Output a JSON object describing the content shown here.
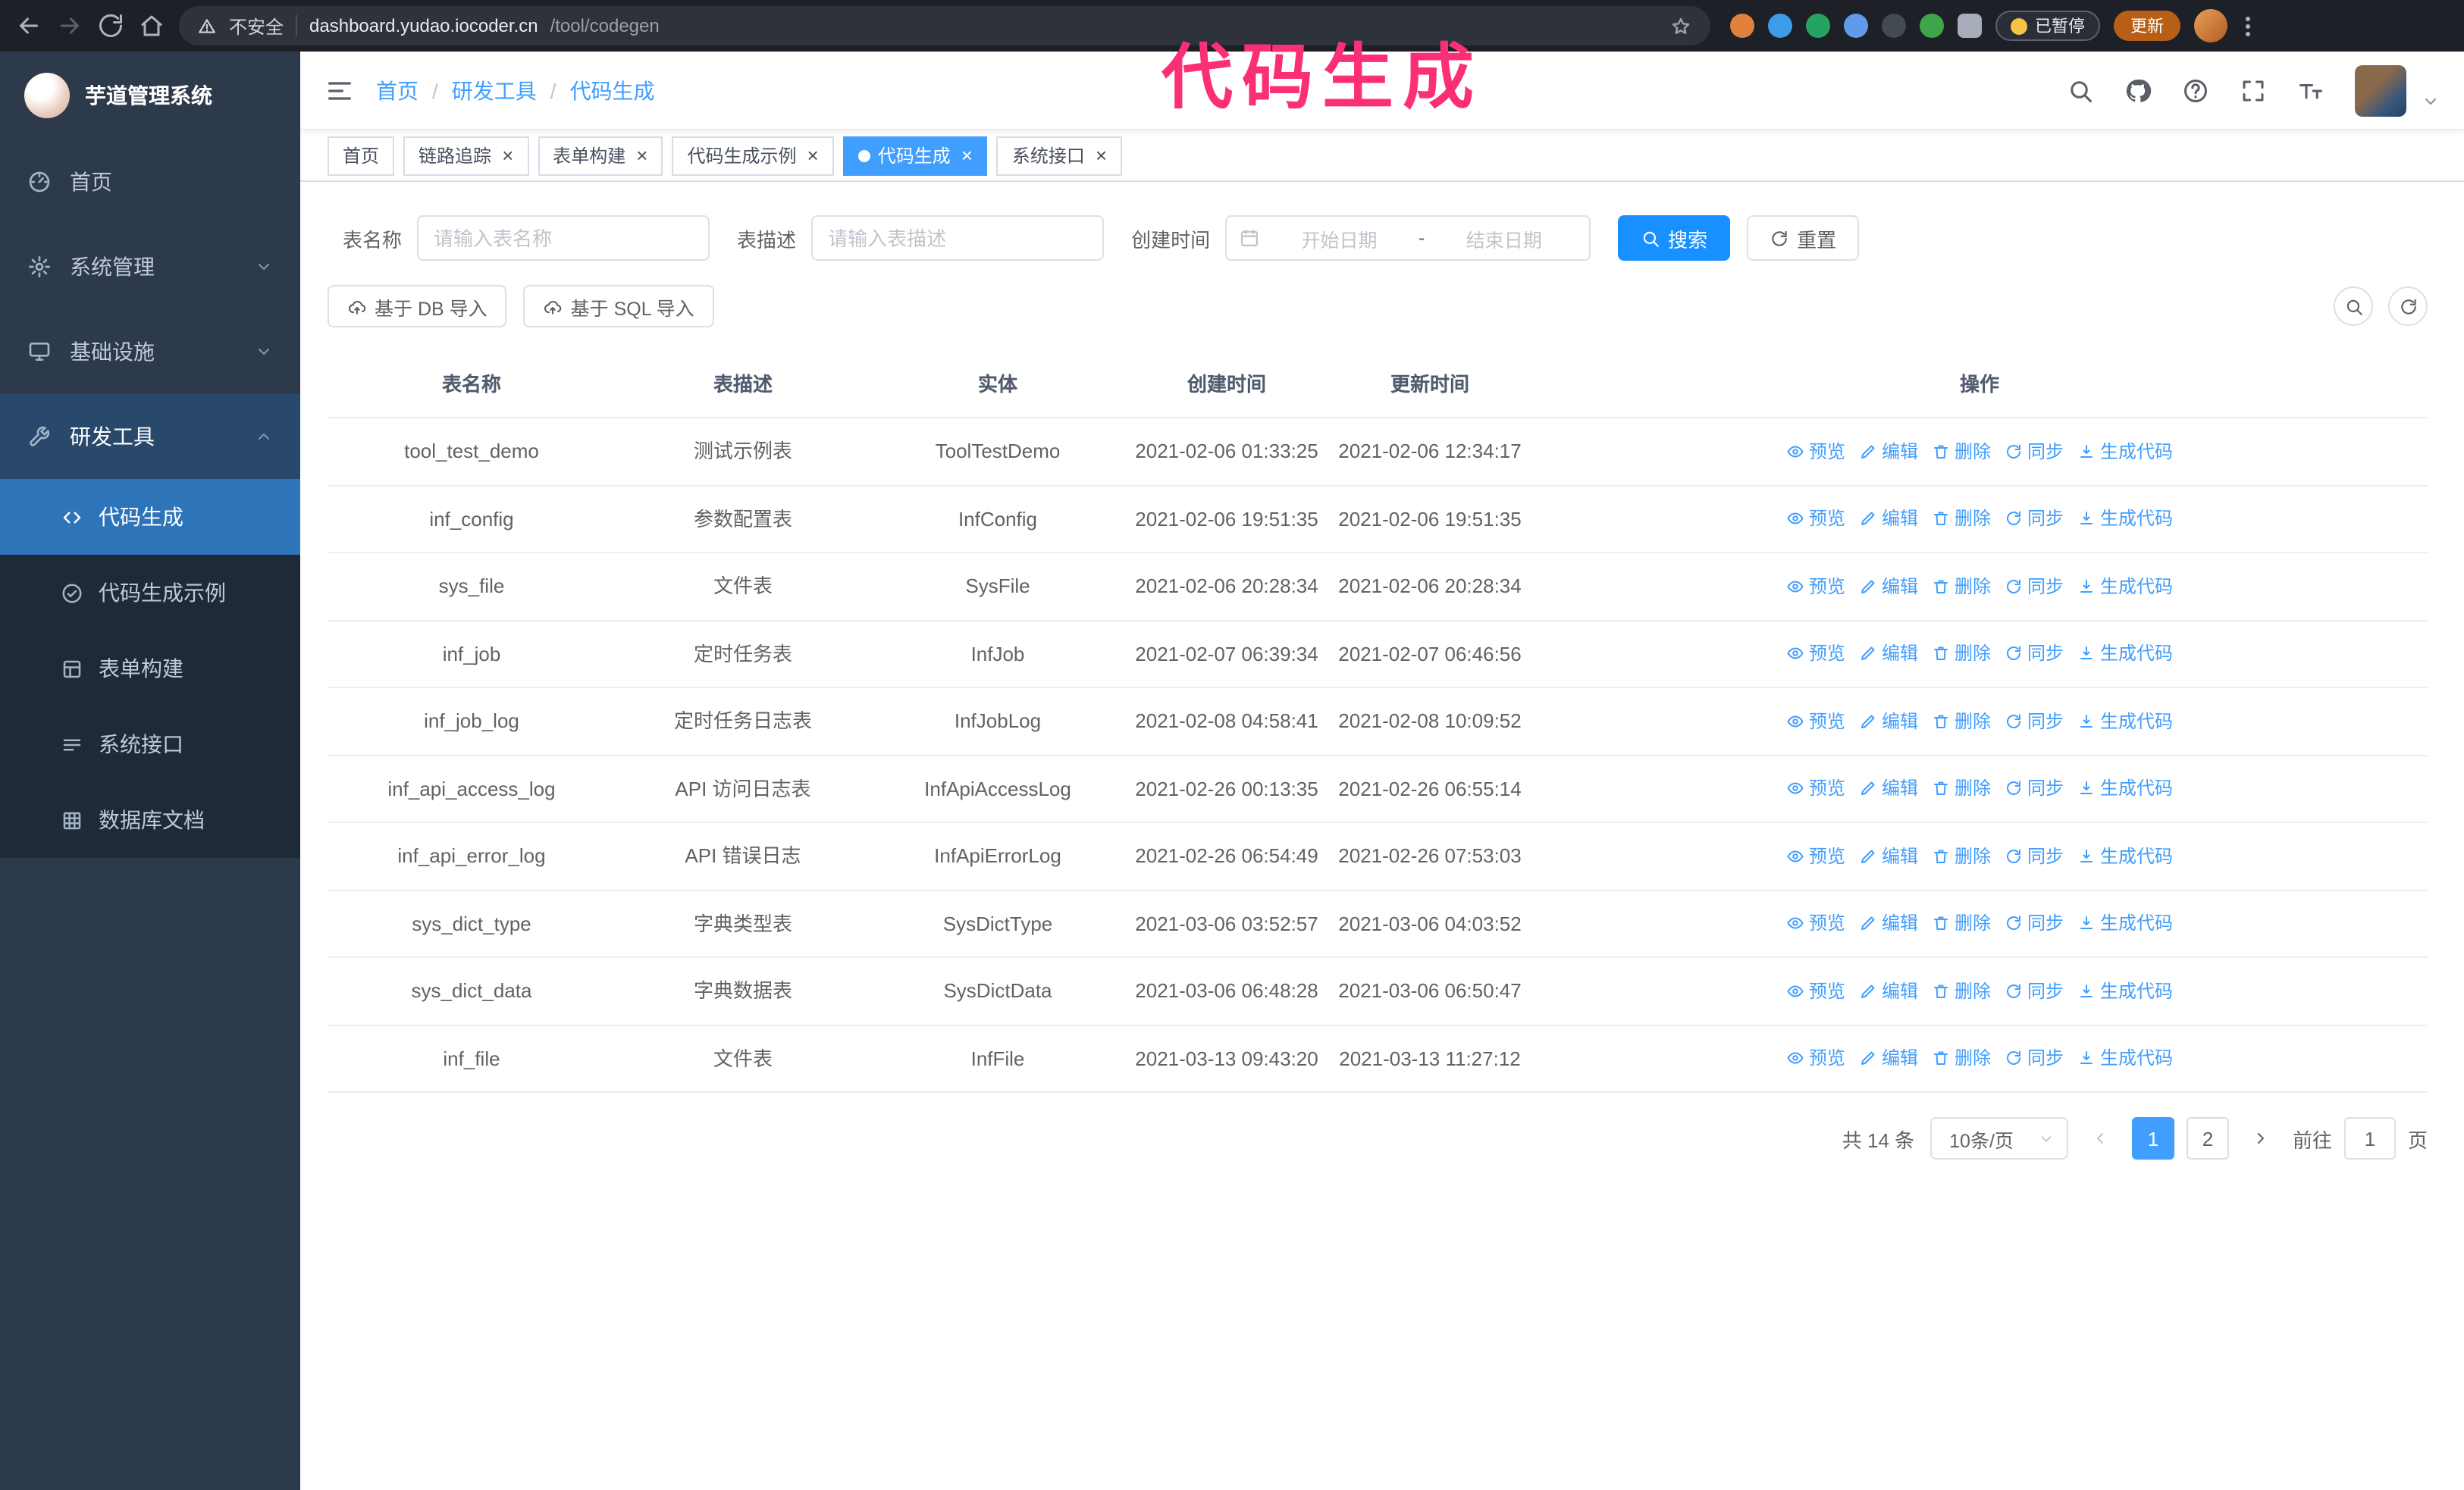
{
  "annotation": {
    "text": "代码生成"
  },
  "browser": {
    "security_label": "不安全",
    "url_domain": "dashboard.yudao.iocoder.cn",
    "url_path": "/tool/codegen",
    "paused_badge": "已暂停",
    "update_button": "更新"
  },
  "sidebar": {
    "logo_title": "芋道管理系统",
    "items": [
      {
        "label": "首页"
      },
      {
        "label": "系统管理"
      },
      {
        "label": "基础设施"
      },
      {
        "label": "研发工具"
      }
    ],
    "subitems": [
      {
        "label": "代码生成"
      },
      {
        "label": "代码生成示例"
      },
      {
        "label": "表单构建"
      },
      {
        "label": "系统接口"
      },
      {
        "label": "数据库文档"
      }
    ]
  },
  "navbar": {
    "breadcrumb_home": "首页",
    "breadcrumb_section": "研发工具",
    "breadcrumb_current": "代码生成",
    "breadcrumb_separator": "/"
  },
  "tabs": [
    {
      "label": "首页",
      "closable": false,
      "active": false
    },
    {
      "label": "链路追踪",
      "closable": true,
      "active": false
    },
    {
      "label": "表单构建",
      "closable": true,
      "active": false
    },
    {
      "label": "代码生成示例",
      "closable": true,
      "active": false
    },
    {
      "label": "代码生成",
      "closable": true,
      "active": true
    },
    {
      "label": "系统接口",
      "closable": true,
      "active": false
    }
  ],
  "icons": {
    "close": "×"
  },
  "filters": {
    "table_name_label": "表名称",
    "table_name_placeholder": "请输入表名称",
    "table_desc_label": "表描述",
    "table_desc_placeholder": "请输入表描述",
    "create_time_label": "创建时间",
    "date_start_placeholder": "开始日期",
    "date_separator": "-",
    "date_end_placeholder": "结束日期",
    "search_button": "搜索",
    "reset_button": "重置"
  },
  "toolbar": {
    "import_db_button": "基于 DB 导入",
    "import_sql_button": "基于 SQL 导入"
  },
  "table": {
    "columns": [
      "表名称",
      "表描述",
      "实体",
      "创建时间",
      "更新时间",
      "操作"
    ],
    "action_labels": {
      "preview": "预览",
      "edit": "编辑",
      "delete": "删除",
      "sync": "同步",
      "generate": "生成代码"
    },
    "rows": [
      {
        "name": "tool_test_demo",
        "desc": "测试示例表",
        "entity": "ToolTestDemo",
        "created": "2021-02-06 01:33:25",
        "updated": "2021-02-06 12:34:17"
      },
      {
        "name": "inf_config",
        "desc": "参数配置表",
        "entity": "InfConfig",
        "created": "2021-02-06 19:51:35",
        "updated": "2021-02-06 19:51:35"
      },
      {
        "name": "sys_file",
        "desc": "文件表",
        "entity": "SysFile",
        "created": "2021-02-06 20:28:34",
        "updated": "2021-02-06 20:28:34"
      },
      {
        "name": "inf_job",
        "desc": "定时任务表",
        "entity": "InfJob",
        "created": "2021-02-07 06:39:34",
        "updated": "2021-02-07 06:46:56"
      },
      {
        "name": "inf_job_log",
        "desc": "定时任务日志表",
        "entity": "InfJobLog",
        "created": "2021-02-08 04:58:41",
        "updated": "2021-02-08 10:09:52"
      },
      {
        "name": "inf_api_access_log",
        "desc": "API 访问日志表",
        "entity": "InfApiAccessLog",
        "created": "2021-02-26 00:13:35",
        "updated": "2021-02-26 06:55:14"
      },
      {
        "name": "inf_api_error_log",
        "desc": "API 错误日志",
        "entity": "InfApiErrorLog",
        "created": "2021-02-26 06:54:49",
        "updated": "2021-02-26 07:53:03"
      },
      {
        "name": "sys_dict_type",
        "desc": "字典类型表",
        "entity": "SysDictType",
        "created": "2021-03-06 03:52:57",
        "updated": "2021-03-06 04:03:52"
      },
      {
        "name": "sys_dict_data",
        "desc": "字典数据表",
        "entity": "SysDictData",
        "created": "2021-03-06 06:48:28",
        "updated": "2021-03-06 06:50:47"
      },
      {
        "name": "inf_file",
        "desc": "文件表",
        "entity": "InfFile",
        "created": "2021-03-13 09:43:20",
        "updated": "2021-03-13 11:27:12"
      }
    ]
  },
  "pagination": {
    "total": "共 14 条",
    "page_size": "10条/页",
    "pages": [
      {
        "label": "1",
        "active": true
      },
      {
        "label": "2",
        "active": false
      }
    ],
    "goto_label": "前往",
    "goto_value": "1",
    "goto_unit": "页"
  }
}
